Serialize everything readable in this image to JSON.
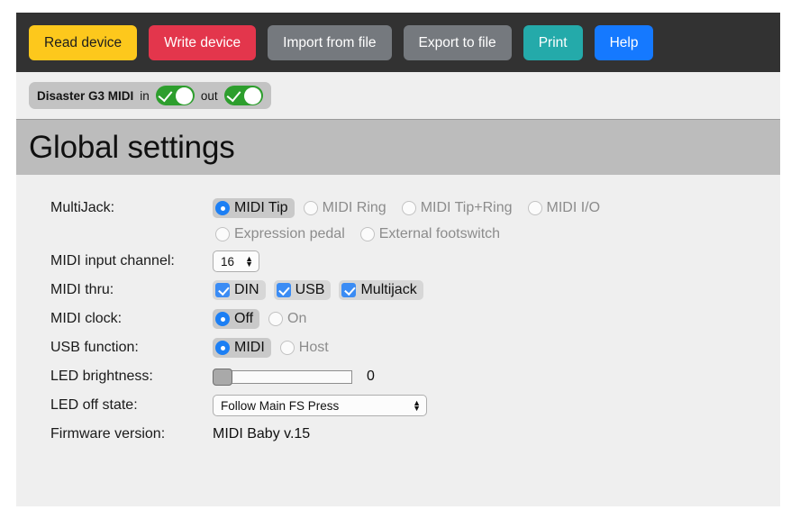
{
  "toolbar": {
    "buttons": [
      {
        "label": "Read device",
        "style": "read"
      },
      {
        "label": "Write device",
        "style": "write"
      },
      {
        "label": "Import from file",
        "style": "grey"
      },
      {
        "label": "Export to file",
        "style": "grey"
      },
      {
        "label": "Print",
        "style": "print"
      },
      {
        "label": "Help",
        "style": "help"
      }
    ],
    "colors": {
      "read": "#fdc81c",
      "write": "#e3364c",
      "grey": "#75797e",
      "print": "#24aaaa",
      "help": "#1579ff",
      "bar": "#323232"
    }
  },
  "device_bar": {
    "device_name": "Disaster G3 MIDI",
    "in_label": "in",
    "out_label": "out",
    "in_state": "on",
    "out_state": "on",
    "toggle_color": "#2d9e2d"
  },
  "page_title": "Global settings",
  "form": {
    "multijack": {
      "label": "MultiJack:",
      "options": [
        {
          "label": "MIDI Tip",
          "selected": true
        },
        {
          "label": "MIDI Ring",
          "selected": false
        },
        {
          "label": "MIDI Tip+Ring",
          "selected": false
        },
        {
          "label": "MIDI I/O",
          "selected": false
        },
        {
          "label": "Expression pedal",
          "selected": false
        },
        {
          "label": "External footswitch",
          "selected": false
        }
      ]
    },
    "midi_input_channel": {
      "label": "MIDI input channel:",
      "value": "16"
    },
    "midi_thru": {
      "label": "MIDI thru:",
      "options": [
        {
          "label": "DIN",
          "checked": true
        },
        {
          "label": "USB",
          "checked": true
        },
        {
          "label": "Multijack",
          "checked": true
        }
      ]
    },
    "midi_clock": {
      "label": "MIDI clock:",
      "options": [
        {
          "label": "Off",
          "selected": true
        },
        {
          "label": "On",
          "selected": false
        }
      ]
    },
    "usb_function": {
      "label": "USB function:",
      "options": [
        {
          "label": "MIDI",
          "selected": true
        },
        {
          "label": "Host",
          "selected": false
        }
      ]
    },
    "led_brightness": {
      "label": "LED brightness:",
      "value": "0",
      "position_percent": 0
    },
    "led_off_state": {
      "label": "LED off state:",
      "value": "Follow Main FS Press"
    },
    "firmware_version": {
      "label": "Firmware version:",
      "value": "MIDI Baby v.15"
    }
  }
}
